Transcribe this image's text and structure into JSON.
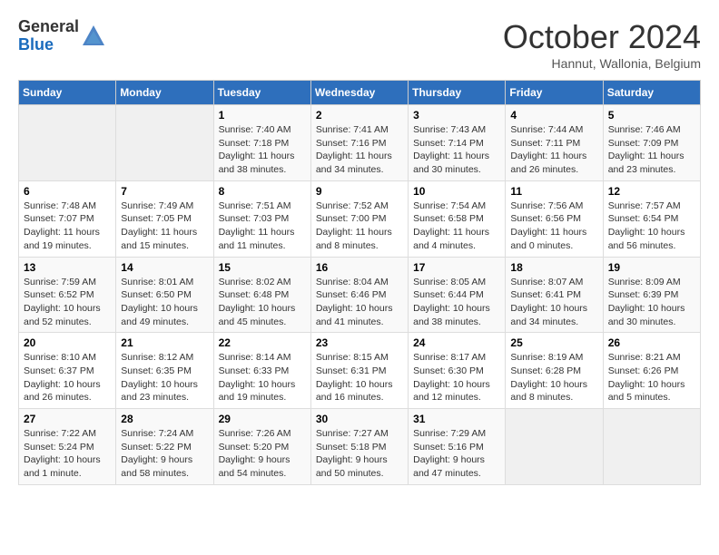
{
  "header": {
    "logo_general": "General",
    "logo_blue": "Blue",
    "month_title": "October 2024",
    "subtitle": "Hannut, Wallonia, Belgium"
  },
  "columns": [
    "Sunday",
    "Monday",
    "Tuesday",
    "Wednesday",
    "Thursday",
    "Friday",
    "Saturday"
  ],
  "weeks": [
    [
      {
        "day": "",
        "sunrise": "",
        "sunset": "",
        "daylight": ""
      },
      {
        "day": "",
        "sunrise": "",
        "sunset": "",
        "daylight": ""
      },
      {
        "day": "1",
        "sunrise": "Sunrise: 7:40 AM",
        "sunset": "Sunset: 7:18 PM",
        "daylight": "Daylight: 11 hours and 38 minutes."
      },
      {
        "day": "2",
        "sunrise": "Sunrise: 7:41 AM",
        "sunset": "Sunset: 7:16 PM",
        "daylight": "Daylight: 11 hours and 34 minutes."
      },
      {
        "day": "3",
        "sunrise": "Sunrise: 7:43 AM",
        "sunset": "Sunset: 7:14 PM",
        "daylight": "Daylight: 11 hours and 30 minutes."
      },
      {
        "day": "4",
        "sunrise": "Sunrise: 7:44 AM",
        "sunset": "Sunset: 7:11 PM",
        "daylight": "Daylight: 11 hours and 26 minutes."
      },
      {
        "day": "5",
        "sunrise": "Sunrise: 7:46 AM",
        "sunset": "Sunset: 7:09 PM",
        "daylight": "Daylight: 11 hours and 23 minutes."
      }
    ],
    [
      {
        "day": "6",
        "sunrise": "Sunrise: 7:48 AM",
        "sunset": "Sunset: 7:07 PM",
        "daylight": "Daylight: 11 hours and 19 minutes."
      },
      {
        "day": "7",
        "sunrise": "Sunrise: 7:49 AM",
        "sunset": "Sunset: 7:05 PM",
        "daylight": "Daylight: 11 hours and 15 minutes."
      },
      {
        "day": "8",
        "sunrise": "Sunrise: 7:51 AM",
        "sunset": "Sunset: 7:03 PM",
        "daylight": "Daylight: 11 hours and 11 minutes."
      },
      {
        "day": "9",
        "sunrise": "Sunrise: 7:52 AM",
        "sunset": "Sunset: 7:00 PM",
        "daylight": "Daylight: 11 hours and 8 minutes."
      },
      {
        "day": "10",
        "sunrise": "Sunrise: 7:54 AM",
        "sunset": "Sunset: 6:58 PM",
        "daylight": "Daylight: 11 hours and 4 minutes."
      },
      {
        "day": "11",
        "sunrise": "Sunrise: 7:56 AM",
        "sunset": "Sunset: 6:56 PM",
        "daylight": "Daylight: 11 hours and 0 minutes."
      },
      {
        "day": "12",
        "sunrise": "Sunrise: 7:57 AM",
        "sunset": "Sunset: 6:54 PM",
        "daylight": "Daylight: 10 hours and 56 minutes."
      }
    ],
    [
      {
        "day": "13",
        "sunrise": "Sunrise: 7:59 AM",
        "sunset": "Sunset: 6:52 PM",
        "daylight": "Daylight: 10 hours and 52 minutes."
      },
      {
        "day": "14",
        "sunrise": "Sunrise: 8:01 AM",
        "sunset": "Sunset: 6:50 PM",
        "daylight": "Daylight: 10 hours and 49 minutes."
      },
      {
        "day": "15",
        "sunrise": "Sunrise: 8:02 AM",
        "sunset": "Sunset: 6:48 PM",
        "daylight": "Daylight: 10 hours and 45 minutes."
      },
      {
        "day": "16",
        "sunrise": "Sunrise: 8:04 AM",
        "sunset": "Sunset: 6:46 PM",
        "daylight": "Daylight: 10 hours and 41 minutes."
      },
      {
        "day": "17",
        "sunrise": "Sunrise: 8:05 AM",
        "sunset": "Sunset: 6:44 PM",
        "daylight": "Daylight: 10 hours and 38 minutes."
      },
      {
        "day": "18",
        "sunrise": "Sunrise: 8:07 AM",
        "sunset": "Sunset: 6:41 PM",
        "daylight": "Daylight: 10 hours and 34 minutes."
      },
      {
        "day": "19",
        "sunrise": "Sunrise: 8:09 AM",
        "sunset": "Sunset: 6:39 PM",
        "daylight": "Daylight: 10 hours and 30 minutes."
      }
    ],
    [
      {
        "day": "20",
        "sunrise": "Sunrise: 8:10 AM",
        "sunset": "Sunset: 6:37 PM",
        "daylight": "Daylight: 10 hours and 26 minutes."
      },
      {
        "day": "21",
        "sunrise": "Sunrise: 8:12 AM",
        "sunset": "Sunset: 6:35 PM",
        "daylight": "Daylight: 10 hours and 23 minutes."
      },
      {
        "day": "22",
        "sunrise": "Sunrise: 8:14 AM",
        "sunset": "Sunset: 6:33 PM",
        "daylight": "Daylight: 10 hours and 19 minutes."
      },
      {
        "day": "23",
        "sunrise": "Sunrise: 8:15 AM",
        "sunset": "Sunset: 6:31 PM",
        "daylight": "Daylight: 10 hours and 16 minutes."
      },
      {
        "day": "24",
        "sunrise": "Sunrise: 8:17 AM",
        "sunset": "Sunset: 6:30 PM",
        "daylight": "Daylight: 10 hours and 12 minutes."
      },
      {
        "day": "25",
        "sunrise": "Sunrise: 8:19 AM",
        "sunset": "Sunset: 6:28 PM",
        "daylight": "Daylight: 10 hours and 8 minutes."
      },
      {
        "day": "26",
        "sunrise": "Sunrise: 8:21 AM",
        "sunset": "Sunset: 6:26 PM",
        "daylight": "Daylight: 10 hours and 5 minutes."
      }
    ],
    [
      {
        "day": "27",
        "sunrise": "Sunrise: 7:22 AM",
        "sunset": "Sunset: 5:24 PM",
        "daylight": "Daylight: 10 hours and 1 minute."
      },
      {
        "day": "28",
        "sunrise": "Sunrise: 7:24 AM",
        "sunset": "Sunset: 5:22 PM",
        "daylight": "Daylight: 9 hours and 58 minutes."
      },
      {
        "day": "29",
        "sunrise": "Sunrise: 7:26 AM",
        "sunset": "Sunset: 5:20 PM",
        "daylight": "Daylight: 9 hours and 54 minutes."
      },
      {
        "day": "30",
        "sunrise": "Sunrise: 7:27 AM",
        "sunset": "Sunset: 5:18 PM",
        "daylight": "Daylight: 9 hours and 50 minutes."
      },
      {
        "day": "31",
        "sunrise": "Sunrise: 7:29 AM",
        "sunset": "Sunset: 5:16 PM",
        "daylight": "Daylight: 9 hours and 47 minutes."
      },
      {
        "day": "",
        "sunrise": "",
        "sunset": "",
        "daylight": ""
      },
      {
        "day": "",
        "sunrise": "",
        "sunset": "",
        "daylight": ""
      }
    ]
  ]
}
